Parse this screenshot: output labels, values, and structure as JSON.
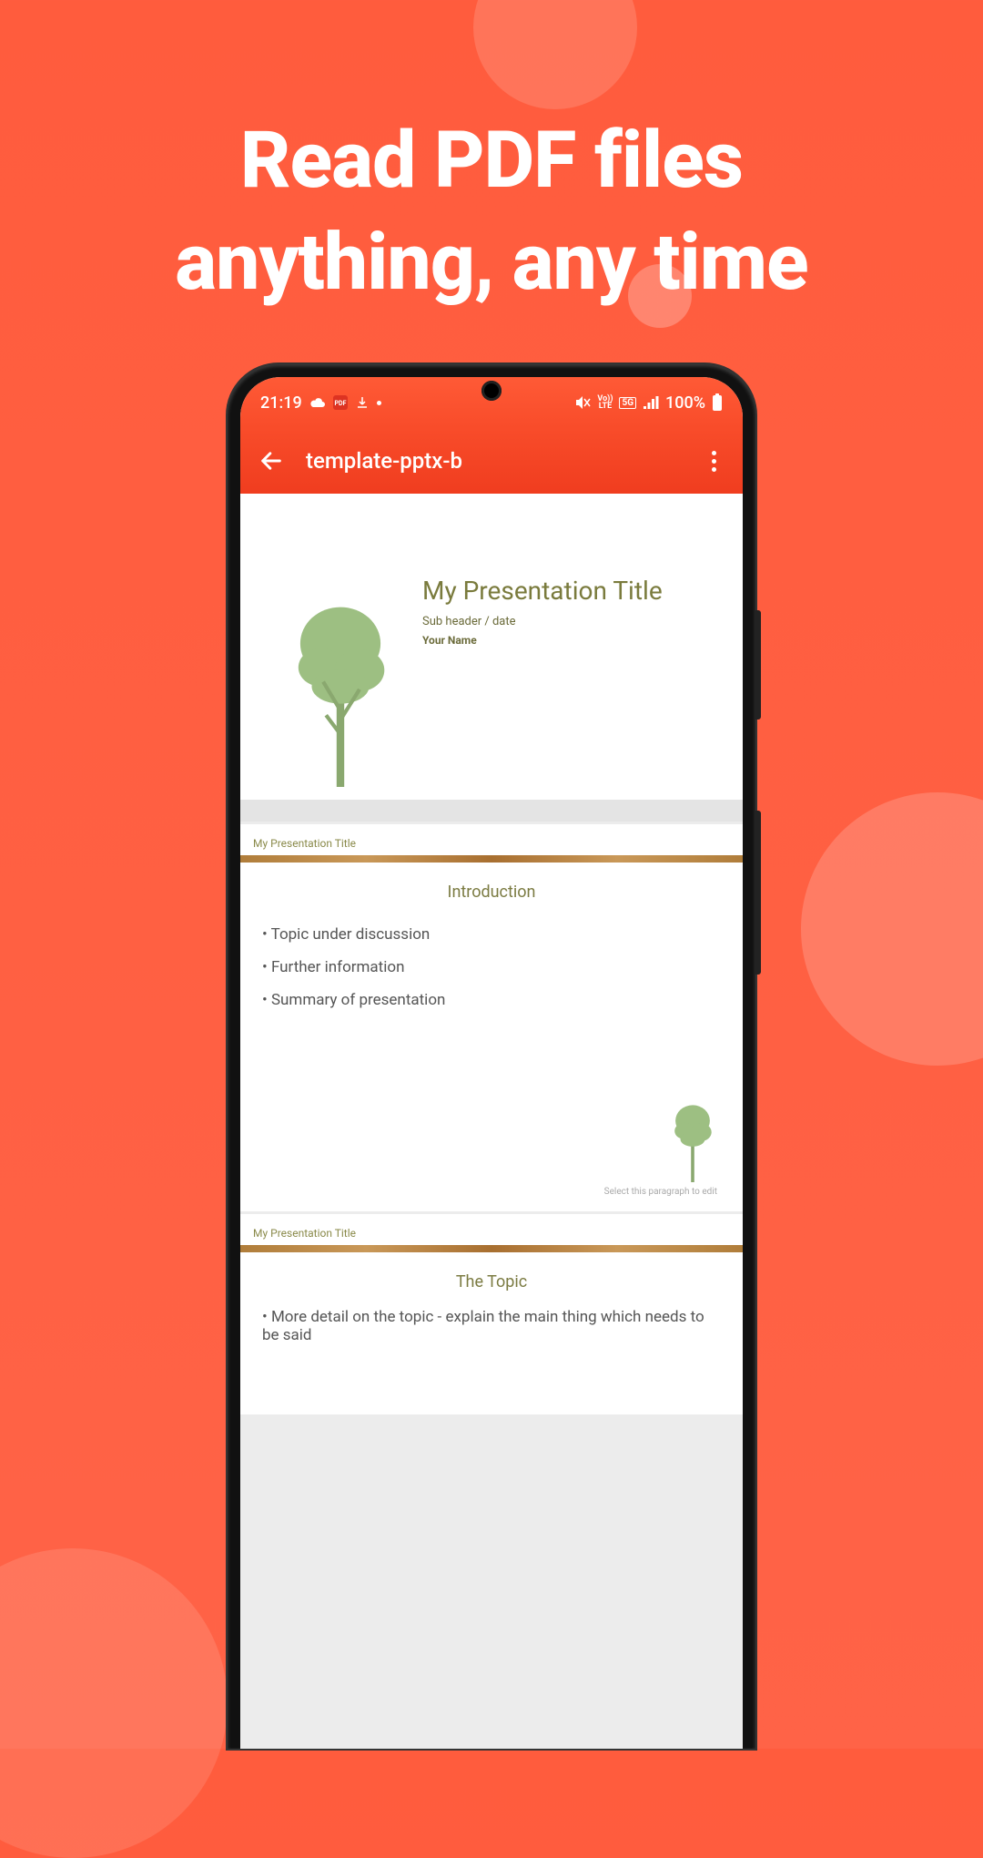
{
  "marketing": {
    "headline_line1": "Read PDF files",
    "headline_line2": "anything, any time"
  },
  "statusbar": {
    "time": "21:19",
    "battery": "100%",
    "indicators": {
      "volte": "Vo))\nLTE",
      "fiveg": "5G"
    }
  },
  "appbar": {
    "title": "template-pptx-b"
  },
  "slide1": {
    "title": "My Presentation Title",
    "sub": "Sub header / date",
    "name": "Your Name"
  },
  "slide2": {
    "header": "My Presentation Title",
    "section": "Introduction",
    "bullets": [
      "• Topic under discussion",
      "• Further information",
      "• Summary of presentation"
    ],
    "hint": "Select this paragraph to edit"
  },
  "slide3": {
    "header": "My Presentation Title",
    "section": "The Topic",
    "bullet": "• More detail on the topic - explain the main thing which needs to be said"
  }
}
